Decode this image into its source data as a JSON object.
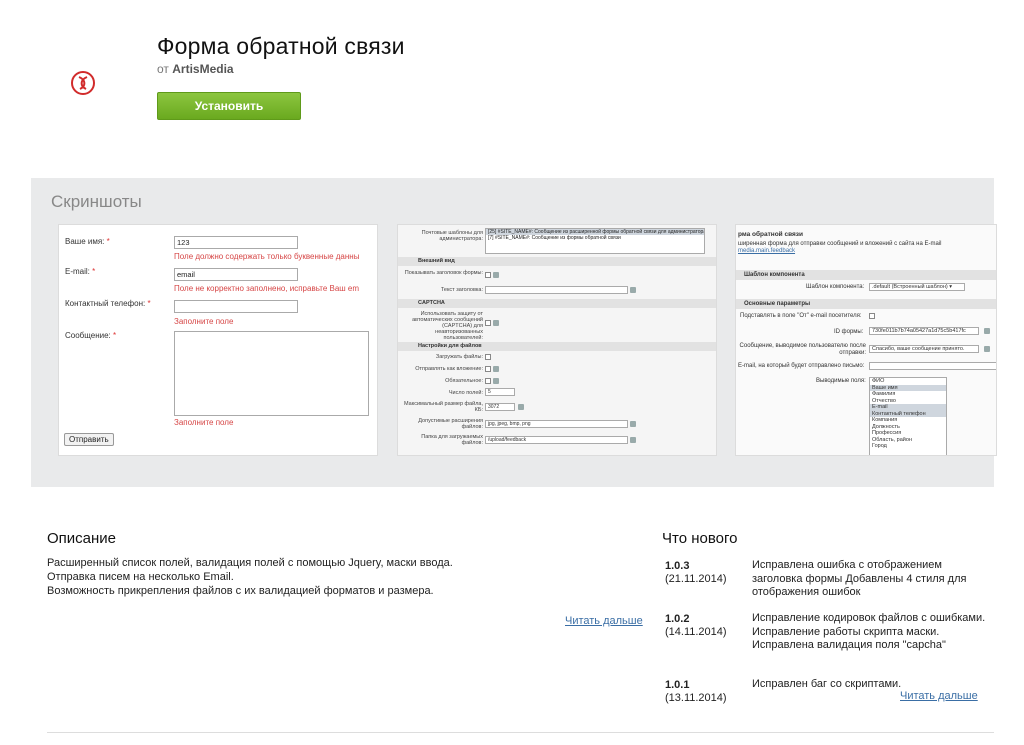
{
  "header": {
    "title": "Форма обратной связи",
    "by_prefix": "от",
    "author": "ArtisMedia",
    "install_label": "Установить",
    "accent_color": "#7ab833"
  },
  "screenshots": {
    "title": "Скриншоты",
    "form": {
      "name_label": "Ваше имя:",
      "name_value": "123",
      "name_error": "Поле должно содержать только буквенные данны",
      "email_label": "E-mail:",
      "email_value": "email",
      "email_error": "Поле не корректно заполнено, исправьте Ваш em",
      "phone_label": "Контактный телефон:",
      "phone_error": "Заполните поле",
      "message_label": "Сообщение:",
      "message_error": "Заполните поле",
      "required_mark": "*",
      "submit_label": "Отправить"
    },
    "settings": {
      "mail_templates_label": "Почтовые шаблоны для администратора:",
      "mail_templates_value1": "[25] #SITE_NAME#: Сообщение из расширенной формы обратной связи для администратора",
      "mail_templates_value2": "[7] #SITE_NAME#: Сообщение из формы обратной связи",
      "section_appearance": "Внешний вид",
      "show_title_label": "Показывать заголовок формы:",
      "title_text_label": "Текст заголовка:",
      "section_captcha": "CAPTCHA",
      "captcha_label": "Использовать защиту от автоматических сообщений (CAPTCHA) для неавторизованных пользователей:",
      "section_files": "Настройки для файлов",
      "upload_files_label": "Загружать файлы:",
      "send_attach_label": "Отправлять как вложение:",
      "required_label": "Обязательное:",
      "fields_count_label": "Число полей:",
      "fields_count_value": "5",
      "max_size_label": "Максимальный размер файла, КБ:",
      "max_size_value": "3072",
      "extensions_label": "Допустимые расширения файлов:",
      "extensions_value": "jpg, jpeg, bmp, png",
      "folder_label": "Папка для загружаемых файлов:",
      "folder_value": "/upload/feedback"
    },
    "component": {
      "title": "рма обратной связи",
      "desc": "ширенная форма для отправки сообщений и вложений с сайта на E-mail",
      "link": "media.main.feedback",
      "section_template": "Шаблон компонента",
      "template_label": "Шаблон компонента:",
      "template_value": ".default (Встроенный шаблон)",
      "section_params": "Основные параметры",
      "from_label": "Подставлять в поле \"От\" e-mail посетителя:",
      "form_id_label": "ID формы:",
      "form_id_value": "730fe011b7b74a05427a1d75c5b417fc",
      "message_label": "Сообщение, выводимое пользователю после отправки:",
      "message_value": "Спасибо, ваше сообщение принято.",
      "email_label": "E-mail, на который будет отправлено письмо:",
      "fields_label": "Выводимые поля:",
      "fields": [
        "ФИО",
        "Ваше имя",
        "Фамилия",
        "Отчество",
        "E-mail",
        "Контактный телефон",
        "Компания",
        "Должность",
        "Профессия",
        "Область, район",
        "Город"
      ]
    }
  },
  "description": {
    "title": "Описание",
    "lines": [
      "Расширенный список полей, валидация полей с помощью Jquery, маски ввода.",
      "Отправка писем на несколько Email.",
      "Возможность прикрепления файлов с их валидацией форматов и размера."
    ],
    "read_more": "Читать дальше"
  },
  "whats_new": {
    "title": "Что нового",
    "entries": [
      {
        "version": "1.0.3",
        "date": "(21.11.2014)",
        "text": "Исправлена ошибка с отображением заголовка формы Добавлены 4 стиля для отображения ошибок"
      },
      {
        "version": "1.0.2",
        "date": "(14.11.2014)",
        "text": "Исправление кодировок файлов с ошибками. Исправление работы скрипта маски. Исправлена валидация поля \"capcha\""
      },
      {
        "version": "1.0.1",
        "date": "(13.11.2014)",
        "text": "Исправлен баг со скриптами."
      }
    ],
    "read_more": "Читать дальше"
  }
}
